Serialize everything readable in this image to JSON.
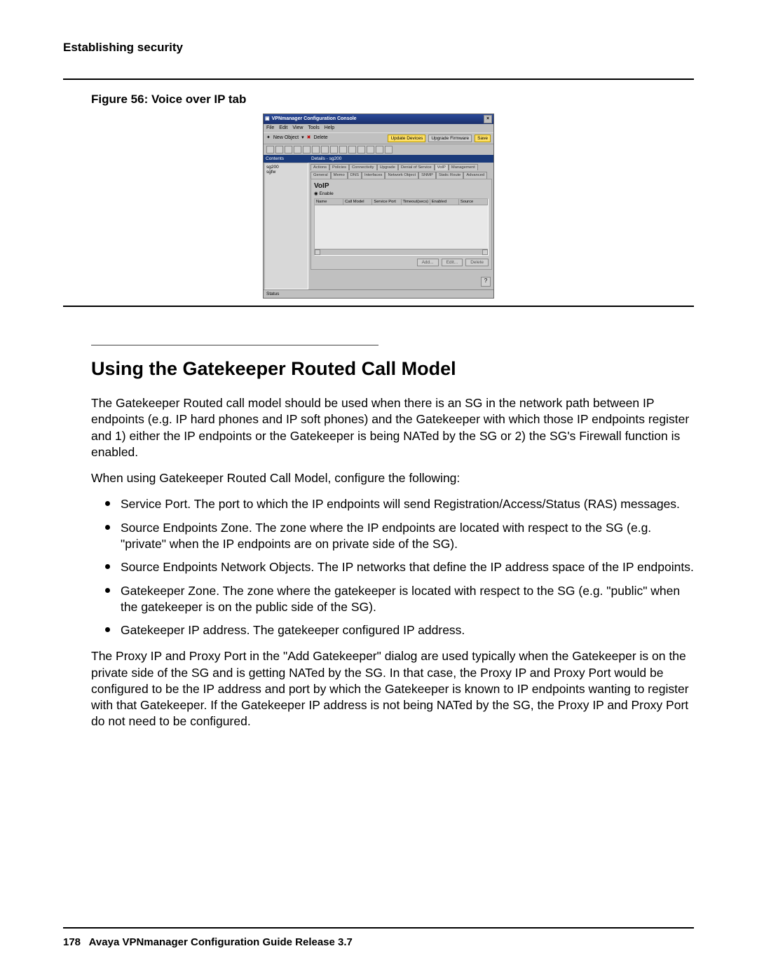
{
  "running_head": "Establishing security",
  "figure_caption": "Figure 56: Voice over IP tab",
  "app": {
    "title": "VPNmanager Configuration Console",
    "menu": [
      "File",
      "Edit",
      "View",
      "Tools",
      "Help"
    ],
    "toolbar1": {
      "new_object": "New Object",
      "delete": "Delete",
      "update": "Update Devices",
      "upgrade": "Upgrade Firmware",
      "save": "Save"
    },
    "sidebar": {
      "header": "Contents",
      "items": [
        "sg200",
        "sgfw"
      ]
    },
    "main": {
      "header": "Details - sg200",
      "tabs_row1": [
        "Actions",
        "Policies",
        "Connectivity",
        "Upgrade",
        "Denial of Service",
        "VoIP",
        "Management"
      ],
      "tabs_row2": [
        "General",
        "Memo",
        "DNS",
        "Interfaces",
        "Network Object",
        "SNMP",
        "Static Route",
        "Advanced"
      ],
      "panel_title": "VoIP",
      "enable": "Enable",
      "columns": [
        "Name",
        "Call Model",
        "Service Port",
        "Timeout(secs)",
        "Enabled",
        "Source"
      ],
      "actions": {
        "add": "Add...",
        "edit": "Edit...",
        "del": "Delete"
      }
    },
    "status": "Status"
  },
  "section_heading": "Using the Gatekeeper Routed Call Model",
  "para1": "The Gatekeeper Routed call model should be used when there is an SG in the network path between IP endpoints (e.g. IP hard phones and IP soft phones) and the Gatekeeper with which those IP endpoints register and 1) either the IP endpoints or the Gatekeeper is being NATed by the SG or 2) the SG's Firewall function is enabled.",
  "para2": "When using Gatekeeper Routed Call Model, configure the following:",
  "bullets": [
    "Service Port. The port to which the IP endpoints will send Registration/Access/Status (RAS) messages.",
    "Source Endpoints Zone. The zone where the IP endpoints are located with respect to the SG (e.g. \"private\" when the IP endpoints are on private side of the SG).",
    "Source Endpoints Network Objects. The IP networks that define the IP address space of the IP endpoints.",
    "Gatekeeper Zone. The zone where the gatekeeper is located with respect to the SG (e.g. \"public\" when the gatekeeper is on the public side of the SG).",
    "Gatekeeper IP address. The gatekeeper configured IP address."
  ],
  "para3": "The Proxy IP and Proxy Port in the \"Add Gatekeeper\" dialog are used typically when the Gatekeeper is on the private side of the SG and is getting NATed by the SG. In that case, the Proxy IP and Proxy Port would be configured to be the IP address and port by which the Gatekeeper is known to IP endpoints wanting to register with that Gatekeeper. If the Gatekeeper IP address is not being NATed by the SG, the Proxy IP and Proxy Port do not need to be configured.",
  "footer": {
    "page": "178",
    "title": "Avaya VPNmanager Configuration Guide Release 3.7"
  }
}
